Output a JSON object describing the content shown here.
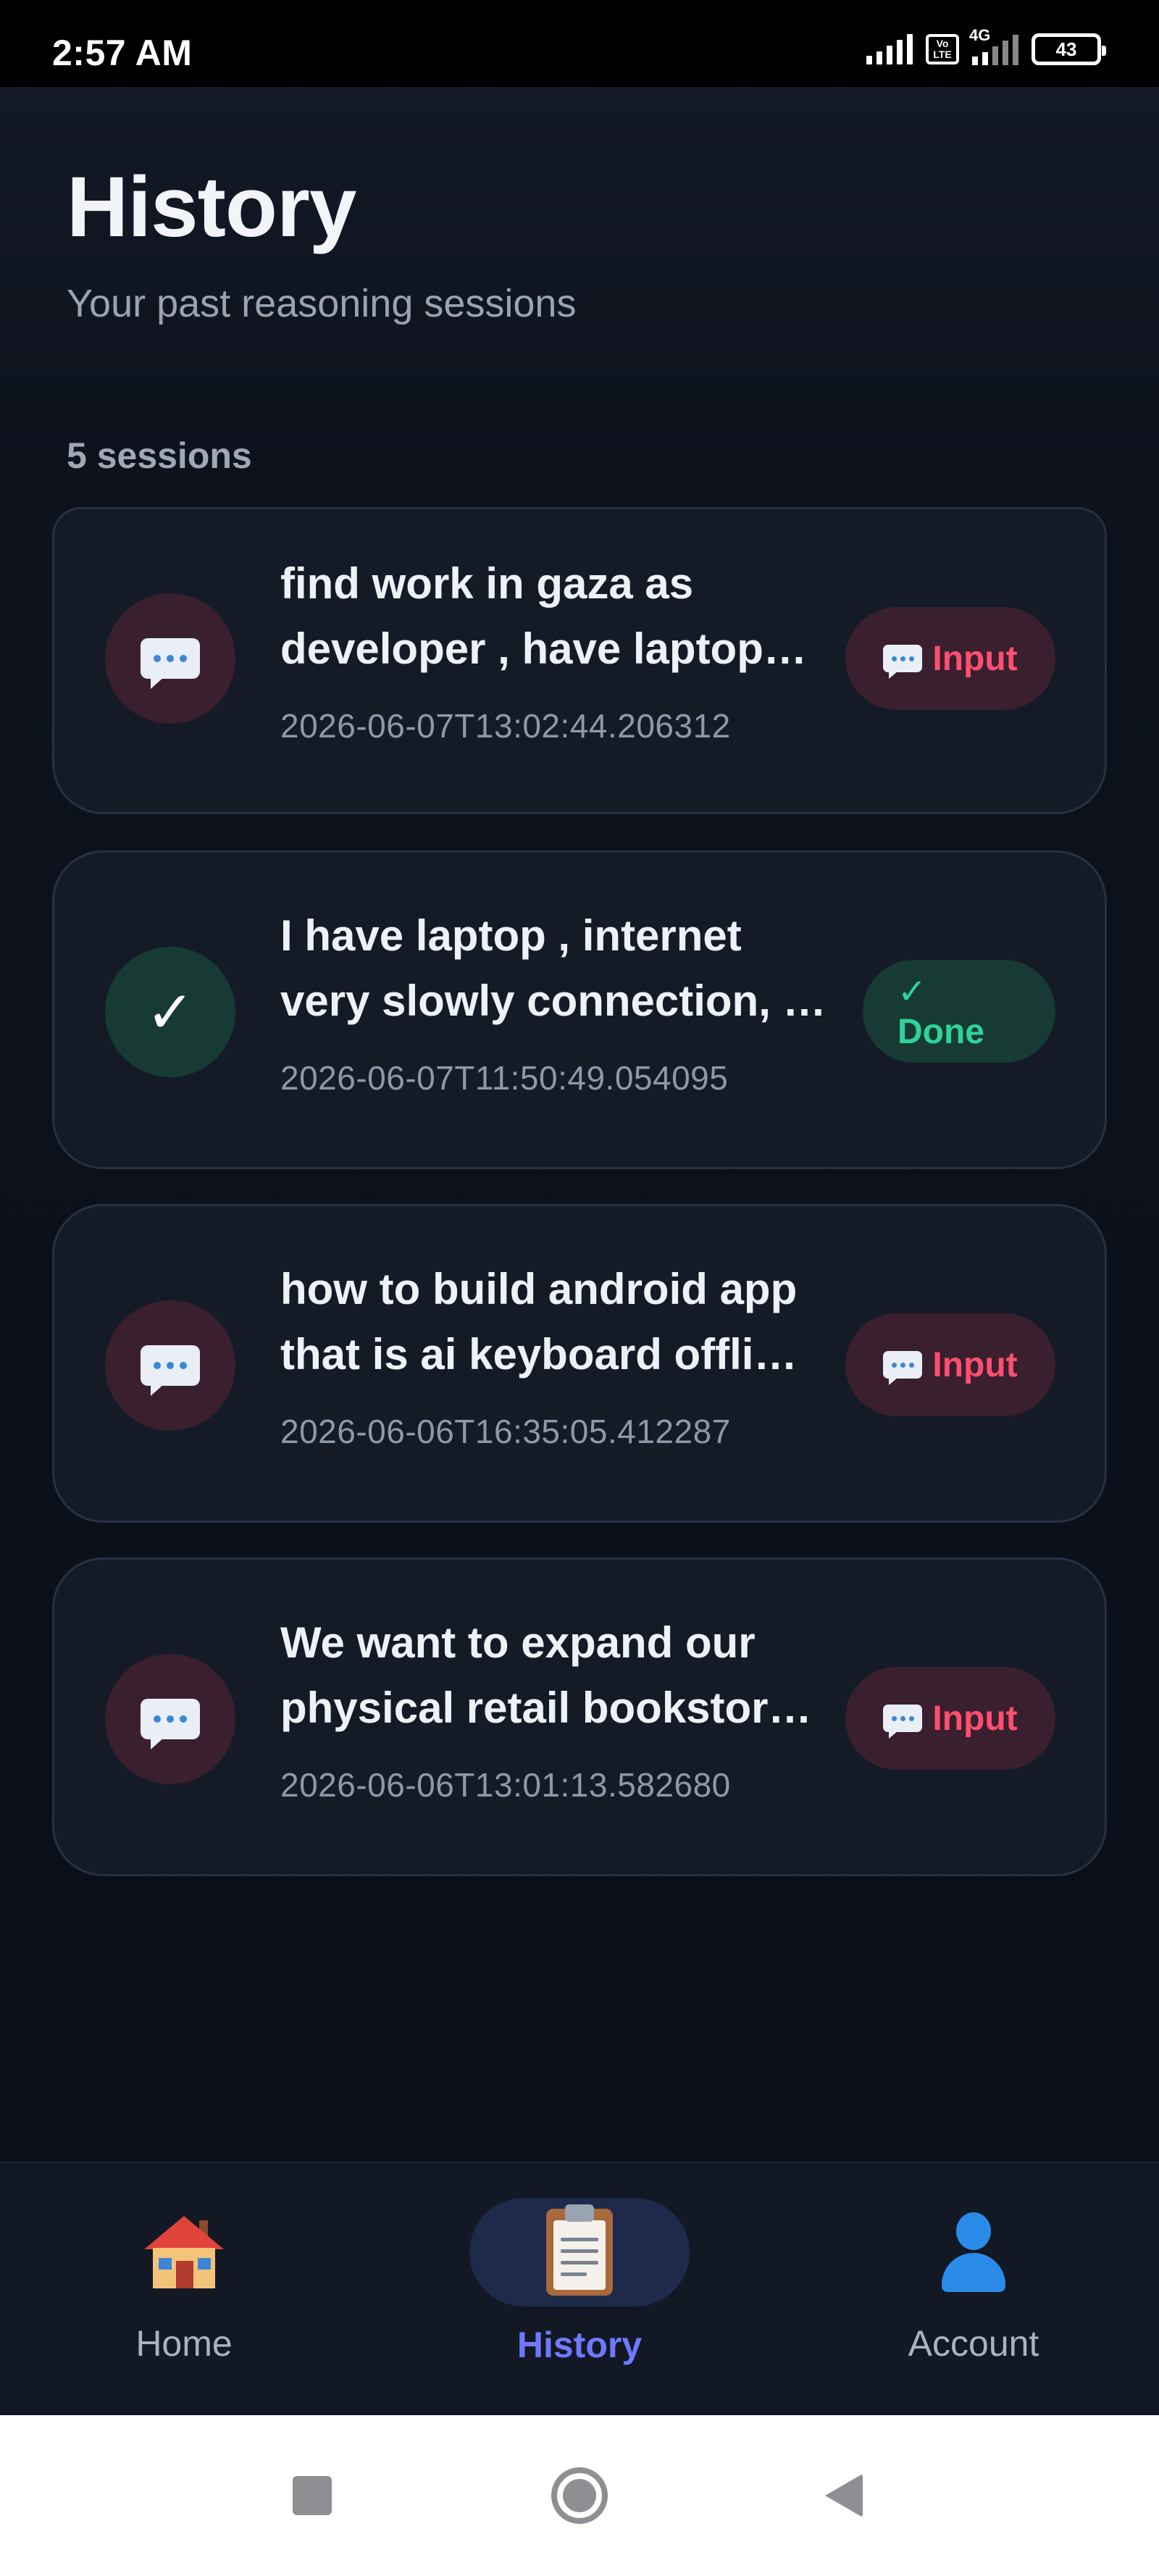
{
  "status_bar": {
    "time": "2:57 AM",
    "network_label": "4G",
    "volte_label": "Vo LTE",
    "battery": "43"
  },
  "header": {
    "title": "History",
    "subtitle": "Your past reasoning sessions"
  },
  "session_count": "5 sessions",
  "sessions": [
    {
      "line1": "find work in gaza as",
      "line2": "developer , have laptop…",
      "timestamp": "2026-06-07T13:02:44.206312",
      "status": "Input",
      "status_icon": "speech-bubble-icon"
    },
    {
      "line1": "I have laptop , internet",
      "line2": "very slowly connection, …",
      "timestamp": "2026-06-07T11:50:49.054095",
      "status": "✓ Done",
      "status_icon": "check-icon",
      "avatar_glyph": "✓"
    },
    {
      "line1": "how to build android app",
      "line2": "that is ai keyboard offli…",
      "timestamp": "2026-06-06T16:35:05.412287",
      "status": "Input",
      "status_icon": "speech-bubble-icon"
    },
    {
      "line1": "We want to expand our",
      "line2": "physical retail bookstor…",
      "timestamp": "2026-06-06T13:01:13.582680",
      "status": "Input",
      "status_icon": "speech-bubble-icon"
    }
  ],
  "bottom_nav": {
    "items": [
      {
        "label": "Home",
        "icon": "house-icon"
      },
      {
        "label": "History",
        "icon": "clipboard-icon",
        "active": true
      },
      {
        "label": "Account",
        "icon": "person-icon"
      }
    ]
  },
  "system_nav": {
    "icons": [
      "recents-square-icon",
      "home-circle-icon",
      "back-triangle-icon"
    ]
  },
  "colors": {
    "background": "#0a0e18",
    "card": "#141b27",
    "input_badge_bg": "#3a1f2e",
    "input_badge_text": "#ff4f71",
    "done_badge_bg": "#173a35",
    "done_badge_text": "#2fd39a",
    "active_nav": "#6f79ff"
  }
}
